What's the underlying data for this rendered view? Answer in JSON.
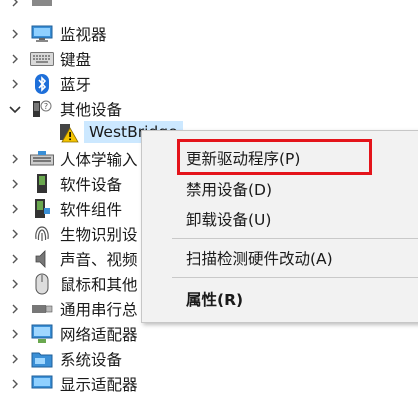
{
  "tree": {
    "items": [
      {
        "label": "监视器",
        "icon": "monitor-icon"
      },
      {
        "label": "键盘",
        "icon": "keyboard-icon"
      },
      {
        "label": "蓝牙",
        "icon": "bluetooth-icon"
      },
      {
        "label": "其他设备",
        "icon": "other-devices-icon"
      },
      {
        "label": "WestBridge",
        "icon": "warning-device-icon"
      },
      {
        "label": "人体学输入",
        "icon": "hid-icon"
      },
      {
        "label": "软件设备",
        "icon": "software-device-icon"
      },
      {
        "label": "软件组件",
        "icon": "software-component-icon"
      },
      {
        "label": "生物识别设",
        "icon": "fingerprint-icon"
      },
      {
        "label": "声音、视频",
        "icon": "speaker-icon"
      },
      {
        "label": "鼠标和其他",
        "icon": "mouse-icon"
      },
      {
        "label": "通用串行总",
        "icon": "usb-icon"
      },
      {
        "label": "网络适配器",
        "icon": "network-icon"
      },
      {
        "label": "系统设备",
        "icon": "system-folder-icon"
      },
      {
        "label": "显示适配器",
        "icon": "display-adapter-icon"
      }
    ]
  },
  "context_menu": {
    "update_driver": "更新驱动程序(P)",
    "disable_device": "禁用设备(D)",
    "uninstall_device": "卸载设备(U)",
    "scan_hardware": "扫描检测硬件改动(A)",
    "properties": "属性(R)"
  },
  "colors": {
    "highlight_border": "#e4141b",
    "selection": "#cce8ff",
    "menu_bg": "#f2f2f2"
  }
}
